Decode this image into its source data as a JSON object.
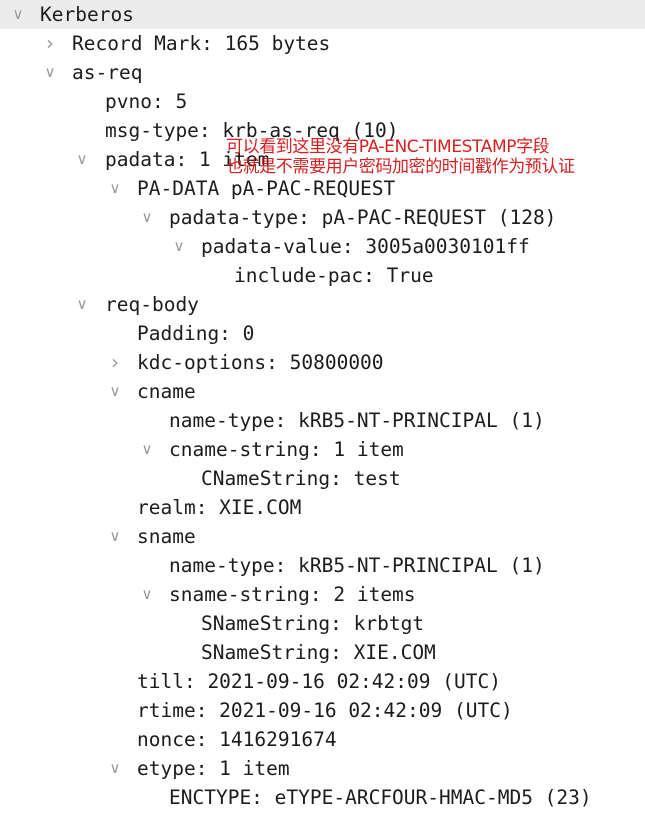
{
  "tree": {
    "kerberos": "Kerberos",
    "record_mark": "Record Mark: 165 bytes",
    "as_req": "as-req",
    "pvno": "pvno: 5",
    "msg_type": "msg-type: krb-as-req (10)",
    "padata": "padata: 1 item",
    "pa_data": "PA-DATA pA-PAC-REQUEST",
    "padata_type": "padata-type: pA-PAC-REQUEST (128)",
    "padata_value": "padata-value: 3005a0030101ff",
    "include_pac": "include-pac: True",
    "req_body": "req-body",
    "padding": "Padding: 0",
    "kdc_options": "kdc-options: 50800000",
    "cname": "cname",
    "cname_name_type": "name-type: kRB5-NT-PRINCIPAL (1)",
    "cname_string": "cname-string: 1 item",
    "cname_string_value": "CNameString: test",
    "realm": "realm: XIE.COM",
    "sname": "sname",
    "sname_name_type": "name-type: kRB5-NT-PRINCIPAL (1)",
    "sname_string": "sname-string: 2 items",
    "sname_string_1": "SNameString: krbtgt",
    "sname_string_2": "SNameString: XIE.COM",
    "till": "till: 2021-09-16 02:42:09 (UTC)",
    "rtime": "rtime: 2021-09-16 02:42:09 (UTC)",
    "nonce": "nonce: 1416291674",
    "etype": "etype: 1 item",
    "enctype": "ENCTYPE: eTYPE-ARCFOUR-HMAC-MD5 (23)"
  },
  "annotation": {
    "line1": "可以看到这里没有PA-ENC-TIMESTAMP字段",
    "line2": "也就是不需要用户密码加密的时间戳作为预认证"
  },
  "colors": {
    "annotation": "#d81e1e",
    "highlight_row": "#ececec",
    "arrow": "#9a9a9a"
  }
}
